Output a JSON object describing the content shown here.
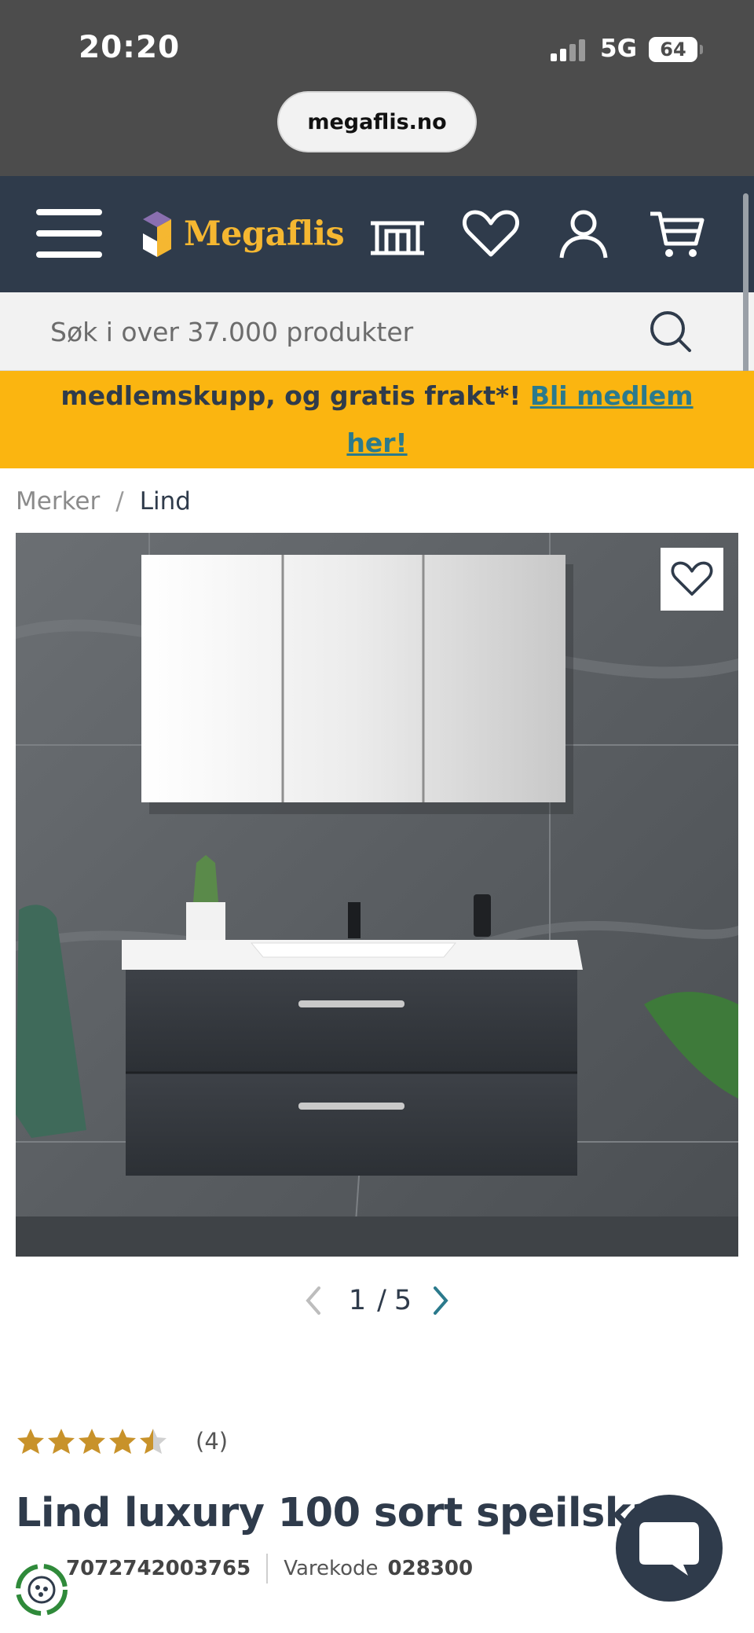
{
  "status_bar": {
    "time": "20:20",
    "network": "5G",
    "battery": "64"
  },
  "browser": {
    "url": "megaflis.no"
  },
  "header": {
    "brand": "Megaflis",
    "icons": [
      "menu-icon",
      "store-icon",
      "heart-icon",
      "user-icon",
      "cart-icon"
    ]
  },
  "search": {
    "placeholder": "Søk i over 37.000 produkter"
  },
  "promo": {
    "text": "medlemskupp, og gratis frakt*! ",
    "link_line1": "Bli medlem",
    "link_line2": "her!"
  },
  "breadcrumb": {
    "root": "Merker",
    "separator": "/",
    "current": "Lind"
  },
  "gallery": {
    "current": "1",
    "separator": "/",
    "total": "5"
  },
  "rating": {
    "value": 4.5,
    "max": 5,
    "count_label": "(4)"
  },
  "product": {
    "title": "Lind luxury 100 sort speilskap",
    "ean": "7072742003765",
    "varekode_label": "Varekode",
    "varekode": "028300"
  },
  "colors": {
    "header_bg": "#2f3b4b",
    "brand_yellow": "#f5b731",
    "promo_bg": "#fbb510",
    "link_teal": "#2b7a8c",
    "star_gold": "#c8922a"
  }
}
